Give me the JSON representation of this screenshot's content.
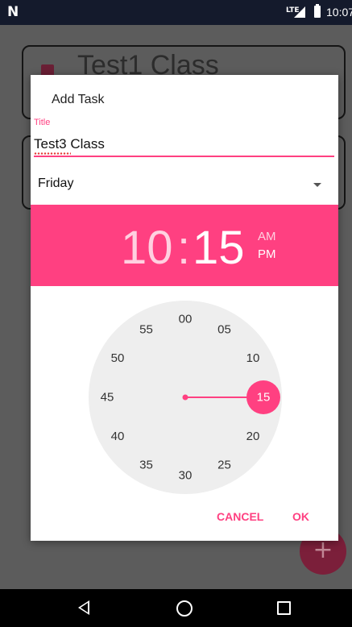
{
  "status_bar": {
    "time": "10:07",
    "network": "LTE",
    "notification_icon": "N"
  },
  "background": {
    "cards": [
      {
        "title": "Test1 Class"
      },
      {
        "title": ""
      }
    ],
    "fab_icon": "+"
  },
  "dialog": {
    "title": "Add Task",
    "field_label": "Title",
    "field_value": "Test3 Class",
    "day_value": "Friday",
    "time": {
      "hour": "10",
      "separator": ":",
      "minute": "15",
      "am": "AM",
      "pm": "PM",
      "selected_period": "PM"
    },
    "clock": {
      "labels": [
        "00",
        "05",
        "10",
        "15",
        "20",
        "25",
        "30",
        "35",
        "40",
        "45",
        "50",
        "55"
      ],
      "selected_minute": 15
    },
    "actions": {
      "cancel": "CANCEL",
      "ok": "OK"
    }
  },
  "colors": {
    "accent": "#ff4081",
    "clock_face": "#eeeeee",
    "status_bar": "#141a2c"
  }
}
